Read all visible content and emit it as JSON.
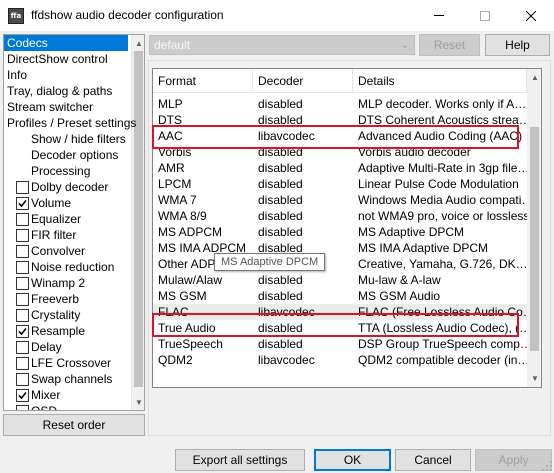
{
  "window": {
    "title": "ffdshow audio decoder configuration",
    "icon_text": "ffa"
  },
  "left_panel": {
    "items": [
      {
        "label": "Codecs",
        "selected": true
      },
      {
        "label": "DirectShow control"
      },
      {
        "label": "Info"
      },
      {
        "label": "Tray, dialog & paths"
      },
      {
        "label": "Stream switcher"
      },
      {
        "label": "Profiles / Preset settings"
      },
      {
        "label": "Show / hide filters"
      },
      {
        "label": "Decoder options"
      },
      {
        "label": "Processing"
      },
      {
        "label": "Dolby decoder",
        "checked": false
      },
      {
        "label": "Volume",
        "checked": true
      },
      {
        "label": "Equalizer",
        "checked": false
      },
      {
        "label": "FIR filter",
        "checked": false
      },
      {
        "label": "Convolver",
        "checked": false
      },
      {
        "label": "Noise reduction",
        "checked": false
      },
      {
        "label": "Winamp 2",
        "checked": false
      },
      {
        "label": "Freeverb",
        "checked": false
      },
      {
        "label": "Crystality",
        "checked": false
      },
      {
        "label": "Resample",
        "checked": true
      },
      {
        "label": "Delay",
        "checked": false
      },
      {
        "label": "LFE Crossover",
        "checked": false
      },
      {
        "label": "Swap channels",
        "checked": false
      },
      {
        "label": "Mixer",
        "checked": true
      },
      {
        "label": "OSD",
        "checked": false
      }
    ],
    "reset_order_label": "Reset order"
  },
  "preset": {
    "selected": "default",
    "reset_label": "Reset",
    "help_label": "Help"
  },
  "codecs_table": {
    "columns": [
      "Format",
      "Decoder",
      "Details"
    ],
    "rows": [
      {
        "format": "MLP",
        "decoder": "disabled",
        "details": "MLP decoder. Works only if A…"
      },
      {
        "format": "DTS",
        "decoder": "disabled",
        "details": "DTS Coherent Acoustics strea…"
      },
      {
        "format": "AAC",
        "decoder": "libavcodec",
        "details": "Advanced Audio Coding (AAC)"
      },
      {
        "format": "Vorbis",
        "decoder": "disabled",
        "details": "Vorbis audio decoder"
      },
      {
        "format": "AMR",
        "decoder": "disabled",
        "details": "Adaptive Multi-Rate in 3gp file…"
      },
      {
        "format": "LPCM",
        "decoder": "disabled",
        "details": "Linear Pulse Code Modulation"
      },
      {
        "format": "WMA 7",
        "decoder": "disabled",
        "details": "Windows Media Audio compati…"
      },
      {
        "format": "WMA 8/9",
        "decoder": "disabled",
        "details": "not WMA9 pro, voice or lossless"
      },
      {
        "format": "MS ADPCM",
        "decoder": "disabled",
        "details": "MS Adaptive DPCM"
      },
      {
        "format": "MS IMA ADPCM",
        "decoder": "disabled",
        "details": "MS IMA Adaptive DPCM"
      },
      {
        "format": "Other ADPCM",
        "decoder": "disabled",
        "details": "Creative, Yamaha, G.726, DK…"
      },
      {
        "format": "Mulaw/Alaw",
        "decoder": "disabled",
        "details": "Mu-law & A-law"
      },
      {
        "format": "MS GSM",
        "decoder": "disabled",
        "details": "MS GSM Audio"
      },
      {
        "format": "FLAC",
        "decoder": "libavcodec",
        "details": "FLAC (Free Lossless Audio Co…"
      },
      {
        "format": "True Audio",
        "decoder": "disabled",
        "details": "TTA (Lossless Audio Codec), (…"
      },
      {
        "format": "TrueSpeech",
        "decoder": "disabled",
        "details": "DSP Group TrueSpeech comp…"
      },
      {
        "format": "QDM2",
        "decoder": "libavcodec",
        "details": "QDM2 compatible decoder (in…"
      }
    ],
    "highlighted_row": "FLAC",
    "tooltip": "MS Adaptive DPCM"
  },
  "footer": {
    "export_label": "Export all settings",
    "ok_label": "OK",
    "cancel_label": "Cancel",
    "apply_label": "Apply"
  },
  "colors": {
    "selection": "#0078d7",
    "annotation_red": "#d7142c",
    "window_bg": "#f0f0f0"
  }
}
